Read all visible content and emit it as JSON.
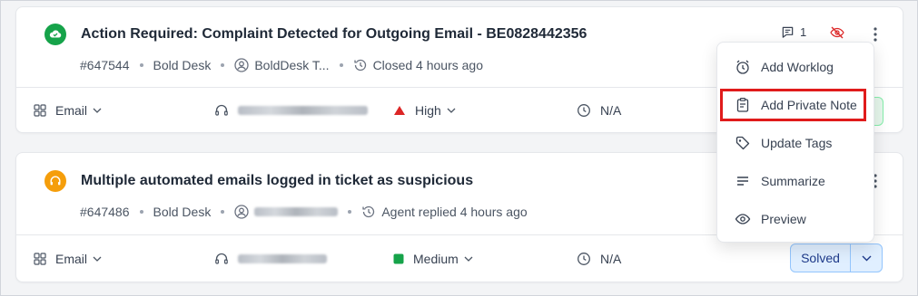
{
  "colors": {
    "accent": "#2563eb",
    "closed_green": "#16a34a",
    "replied_orange": "#f59e0b",
    "high_red": "#dc2626",
    "medium_green": "#16a34a",
    "highlight_red": "#e01b1b"
  },
  "tickets": [
    {
      "status_icon": "cloud-check-icon",
      "title": "Action Required: Complaint Detected for Outgoing Email - BE0828442356",
      "id": "#647544",
      "brand": "Bold Desk",
      "requester": "BoldDesk T...",
      "activity": "Closed 4 hours ago",
      "comment_count": "1",
      "channel": "Email",
      "priority": "High",
      "due": "N/A"
    },
    {
      "status_icon": "headset-icon",
      "title": "Multiple automated emails logged in ticket as suspicious",
      "id": "#647486",
      "brand": "Bold Desk",
      "activity": "Agent replied 4 hours ago",
      "channel": "Email",
      "priority": "Medium",
      "due": "N/A",
      "status": "Solved"
    }
  ],
  "menu": {
    "items": [
      {
        "label": "Add Worklog",
        "icon": "timer-icon"
      },
      {
        "label": "Add Private Note",
        "icon": "note-icon"
      },
      {
        "label": "Update Tags",
        "icon": "tag-icon"
      },
      {
        "label": "Summarize",
        "icon": "summarize-icon"
      },
      {
        "label": "Preview",
        "icon": "eye-icon"
      }
    ]
  }
}
